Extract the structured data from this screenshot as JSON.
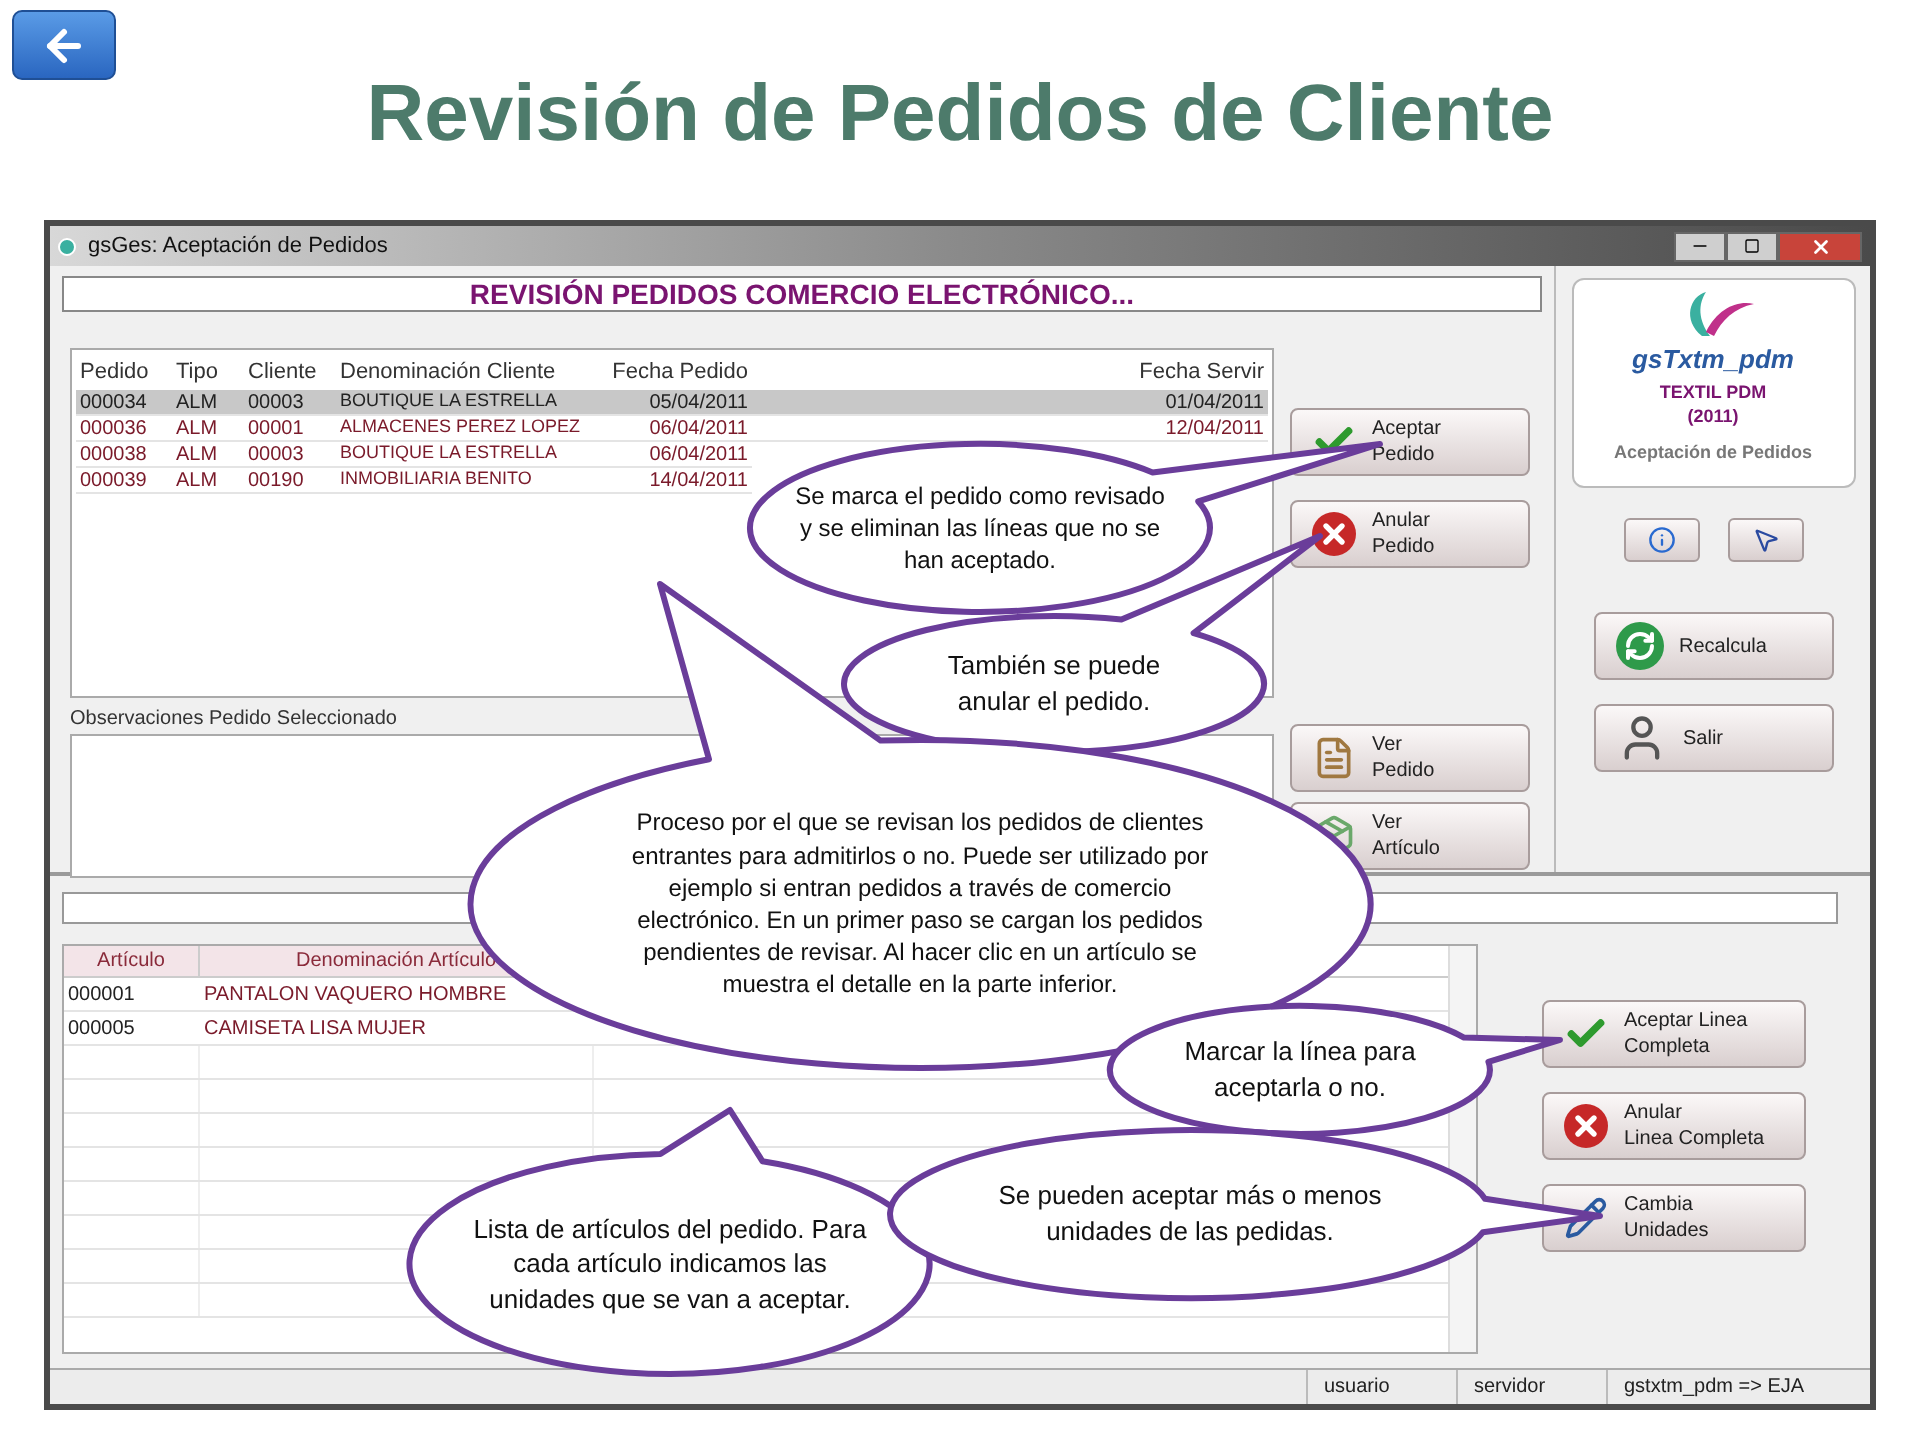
{
  "title": "Revisión de Pedidos de Cliente",
  "window": {
    "title": "gsGes: Aceptación de Pedidos"
  },
  "header_banner": "REVISIÓN PEDIDOS COMERCIO ELECTRÓNICO...",
  "orders_table": {
    "columns": {
      "pedido": "Pedido",
      "tipo": "Tipo",
      "cliente": "Cliente",
      "denominacion": "Denominación Cliente",
      "fecha_pedido": "Fecha Pedido",
      "fecha_servir": "Fecha Servir"
    },
    "rows": [
      {
        "pedido": "000034",
        "tipo": "ALM",
        "cliente": "00003",
        "denominacion": "BOUTIQUE LA ESTRELLA",
        "fecha_pedido": "05/04/2011",
        "fecha_servir": "01/04/2011",
        "selected": true
      },
      {
        "pedido": "000036",
        "tipo": "ALM",
        "cliente": "00001",
        "denominacion": "ALMACENES PEREZ LOPEZ",
        "fecha_pedido": "06/04/2011",
        "fecha_servir": "12/04/2011",
        "selected": false
      },
      {
        "pedido": "000038",
        "tipo": "ALM",
        "cliente": "00003",
        "denominacion": "BOUTIQUE LA ESTRELLA",
        "fecha_pedido": "06/04/2011",
        "selected": false
      },
      {
        "pedido": "000039",
        "tipo": "ALM",
        "cliente": "00190",
        "denominacion": "INMOBILIARIA BENITO",
        "fecha_pedido": "14/04/2011",
        "selected": false
      }
    ]
  },
  "order_buttons": [
    {
      "kind": "accept",
      "lines": [
        "Aceptar",
        "Pedido"
      ]
    },
    {
      "kind": "cancel",
      "lines": [
        "Anular",
        "Pedido"
      ]
    },
    {
      "kind": "view_order",
      "lines": [
        "Ver",
        "Pedido"
      ]
    },
    {
      "kind": "view_item",
      "lines": [
        "Ver",
        "Artículo"
      ]
    }
  ],
  "observations": {
    "label": "Observaciones Pedido Seleccionado"
  },
  "side_panel": {
    "logo": {
      "name": "gsTxtm_pdm",
      "company": "TEXTIL PDM",
      "year": "(2011)",
      "caption": "Aceptación de Pedidos"
    },
    "buttons": [
      {
        "kind": "recalc",
        "label": "Recalcula"
      },
      {
        "kind": "exit",
        "label": "Salir"
      }
    ]
  },
  "articles_table": {
    "columns": {
      "articulo": "Artículo",
      "denominacion": "Denominación Artículo"
    },
    "rows": [
      {
        "articulo": "000001",
        "denominacion": "PANTALON VAQUERO HOMBRE"
      },
      {
        "articulo": "000005",
        "denominacion": "CAMISETA LISA MUJER"
      }
    ]
  },
  "line_buttons": [
    {
      "kind": "accept",
      "lines": [
        "Aceptar Linea",
        "Completa"
      ]
    },
    {
      "kind": "cancel",
      "lines": [
        "Anular",
        "Linea Completa"
      ]
    },
    {
      "kind": "units",
      "lines": [
        "Cambia",
        "Unidades"
      ]
    }
  ],
  "status_bar": [
    "usuario",
    "servidor",
    "gstxtm_pdm => EJA"
  ],
  "callouts": [
    {
      "text": "Se marca el pedido como revisado y se eliminan las líneas que no se han aceptado."
    },
    {
      "text": "También se puede anular el pedido."
    },
    {
      "text": "Proceso por el que se revisan los pedidos de clientes entrantes para admitirlos o no. Puede ser utilizado por ejemplo si entran pedidos a través de comercio electrónico. En un primer paso se cargan los pedidos pendientes de revisar. Al hacer clic en un artículo se muestra el detalle en la parte inferior."
    },
    {
      "text": "Marcar la línea para aceptarla o no."
    },
    {
      "text": "Lista de artículos del pedido. Para cada artículo indicamos las unidades que se van a aceptar."
    },
    {
      "text": "Se pueden aceptar más o menos unidades de las pedidas."
    }
  ]
}
